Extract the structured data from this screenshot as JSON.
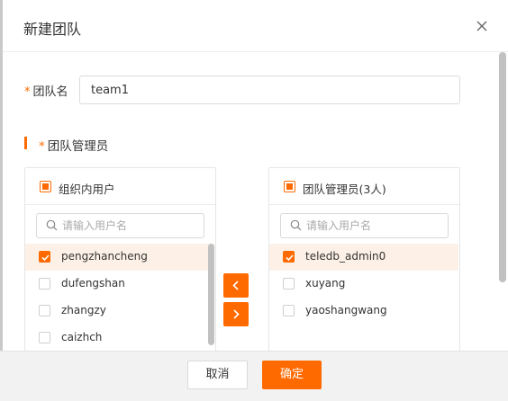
{
  "dialog": {
    "title": "新建团队",
    "close_icon": "close-icon"
  },
  "form": {
    "team_name_label": "团队名",
    "team_name_value": "team1",
    "required_mark": "*",
    "admins_section_label": "团队管理员"
  },
  "left_panel": {
    "title": "组织内用户",
    "search_placeholder": "请输入用户名",
    "items": [
      {
        "label": "pengzhancheng",
        "checked": true
      },
      {
        "label": "dufengshan",
        "checked": false
      },
      {
        "label": "zhangzy",
        "checked": false
      },
      {
        "label": "caizhch",
        "checked": false
      }
    ]
  },
  "right_panel": {
    "title": "团队管理员(3人)",
    "search_placeholder": "请输入用户名",
    "items": [
      {
        "label": "teledb_admin0",
        "checked": true
      },
      {
        "label": "xuyang",
        "checked": false
      },
      {
        "label": "yaoshangwang",
        "checked": false
      }
    ]
  },
  "transfer": {
    "left_label": "<",
    "right_label": ">"
  },
  "footer": {
    "cancel_label": "取消",
    "ok_label": "确定"
  },
  "colors": {
    "accent": "#ff6a00"
  }
}
